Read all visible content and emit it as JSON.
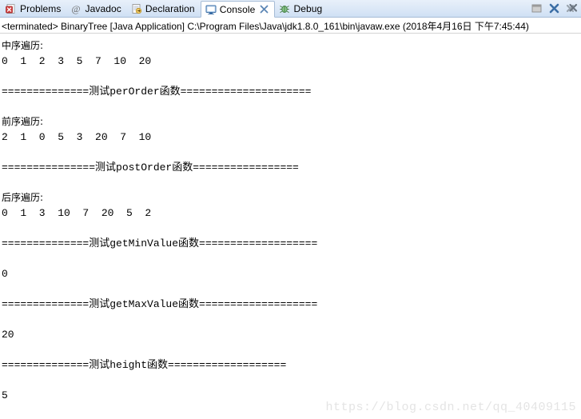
{
  "colors": {
    "tabbar_bg": "#dce8f7",
    "tabbar_border": "#a6bcd6",
    "active_tab_bg": "#ffffff",
    "console_bg": "#ffffff",
    "text": "#000000",
    "watermark": "#e4e4e4",
    "problems_icon": "#c83737",
    "console_icon": "#3b7cc4",
    "declaration_icon": "#f0c674",
    "debug_icon": "#4f9a4f",
    "close_x": "#3b6ea5"
  },
  "tabbar": {
    "tabs": [
      {
        "label": "Problems",
        "icon": "problems-icon",
        "active": false,
        "closable": false
      },
      {
        "label": "Javadoc",
        "icon": "javadoc-icon",
        "active": false,
        "closable": false
      },
      {
        "label": "Declaration",
        "icon": "declaration-icon",
        "active": false,
        "closable": false
      },
      {
        "label": "Console",
        "icon": "console-icon",
        "active": true,
        "closable": true
      },
      {
        "label": "Debug",
        "icon": "debug-icon",
        "active": false,
        "closable": false
      }
    ],
    "tools": [
      {
        "name": "minimize-icon",
        "title": "Minimize"
      },
      {
        "name": "close-icon",
        "title": "Close"
      },
      {
        "name": "close-all-icon",
        "title": "Close All"
      }
    ]
  },
  "launch": {
    "status": "<terminated>",
    "config_name": "BinaryTree",
    "type": "[Java Application]",
    "path": "C:\\Program Files\\Java\\jdk1.8.0_161\\bin\\javaw.exe",
    "timestamp": "(2018年4月16日 下午7:45:44)",
    "full_text": "<terminated> BinaryTree [Java Application] C:\\Program Files\\Java\\jdk1.8.0_161\\bin\\javaw.exe (2018年4月16日 下午7:45:44)"
  },
  "console": {
    "lines": [
      {
        "id": "inorder-label",
        "text": "中序遍历:",
        "type": "cjk"
      },
      {
        "id": "inorder-values",
        "text": "0  1  2  3  5  7  10  20",
        "type": "mono"
      },
      {
        "id": "blank-1",
        "text": "",
        "type": "blank"
      },
      {
        "id": "sep-perorder",
        "text": "==============测试perOrder函数=====================",
        "type": "sep"
      },
      {
        "id": "blank-2",
        "text": "",
        "type": "blank"
      },
      {
        "id": "preorder-label",
        "text": "前序遍历:",
        "type": "cjk"
      },
      {
        "id": "preorder-values",
        "text": "2  1  0  5  3  20  7  10",
        "type": "mono"
      },
      {
        "id": "blank-3",
        "text": "",
        "type": "blank"
      },
      {
        "id": "sep-postorder",
        "text": "===============测试postOrder函数=================",
        "type": "sep"
      },
      {
        "id": "blank-4",
        "text": "",
        "type": "blank"
      },
      {
        "id": "postorder-label",
        "text": "后序遍历:",
        "type": "cjk"
      },
      {
        "id": "postorder-values",
        "text": "0  1  3  10  7  20  5  2",
        "type": "mono"
      },
      {
        "id": "blank-5",
        "text": "",
        "type": "blank"
      },
      {
        "id": "sep-getminvalue",
        "text": "==============测试getMinValue函数===================",
        "type": "sep"
      },
      {
        "id": "blank-6",
        "text": "",
        "type": "blank"
      },
      {
        "id": "minvalue-result",
        "text": "0",
        "type": "mono"
      },
      {
        "id": "blank-7",
        "text": "",
        "type": "blank"
      },
      {
        "id": "sep-getmaxvalue",
        "text": "==============测试getMaxValue函数===================",
        "type": "sep"
      },
      {
        "id": "blank-8",
        "text": "",
        "type": "blank"
      },
      {
        "id": "maxvalue-result",
        "text": "20",
        "type": "mono"
      },
      {
        "id": "blank-9",
        "text": "",
        "type": "blank"
      },
      {
        "id": "sep-height",
        "text": "==============测试height函数===================",
        "type": "sep"
      },
      {
        "id": "blank-10",
        "text": "",
        "type": "blank"
      },
      {
        "id": "height-result",
        "text": "5",
        "type": "mono"
      }
    ]
  },
  "watermark": {
    "text": "https://blog.csdn.net/qq_40409115"
  }
}
